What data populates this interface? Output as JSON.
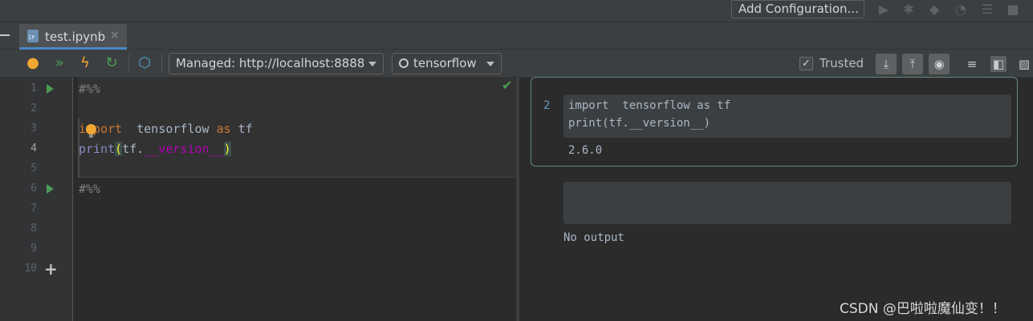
{
  "top_toolbar": {
    "add_configuration_label": "Add Configuration...",
    "icons": [
      "run-icon",
      "debug-icon",
      "coverage-icon",
      "profile-icon",
      "run-build-icon",
      "stop-icon"
    ]
  },
  "tab": {
    "label": "test.ipynb",
    "close_glyph": "×"
  },
  "notebook_toolbar": {
    "server_label": "Managed: http://localhost:8888",
    "kernel_label": "tensorflow",
    "trusted_label": "Trusted",
    "trusted_checked": true,
    "checkbox_glyph": "✓"
  },
  "editor": {
    "line_numbers": [
      "1",
      "2",
      "3",
      "4",
      "5",
      "6",
      "7",
      "8",
      "9",
      "10"
    ],
    "cell_marker_1": "#%%",
    "cell_marker_2": "#%%",
    "line3_keyword": "import",
    "line3_module": "  tensorflow ",
    "line3_as": "as",
    "line3_alias": " tf",
    "line4_builtin": "print",
    "line4_open": "(",
    "line4_obj": "tf.",
    "line4_attr": "__version__",
    "line4_close": ")",
    "add_cell_glyph": "+"
  },
  "preview": {
    "execution_count": "2",
    "code_line_1": "import  tensorflow as tf",
    "code_line_2": "print(tf.__version__)",
    "output": "2.6.0",
    "empty_output": "No output"
  },
  "watermark": "CSDN @巴啦啦魔仙变！！",
  "colors": {
    "run_green": "#499c54",
    "accent_blue": "#4a88c7",
    "keyword_orange": "#cc7832",
    "dunder_purple": "#b200b2"
  }
}
